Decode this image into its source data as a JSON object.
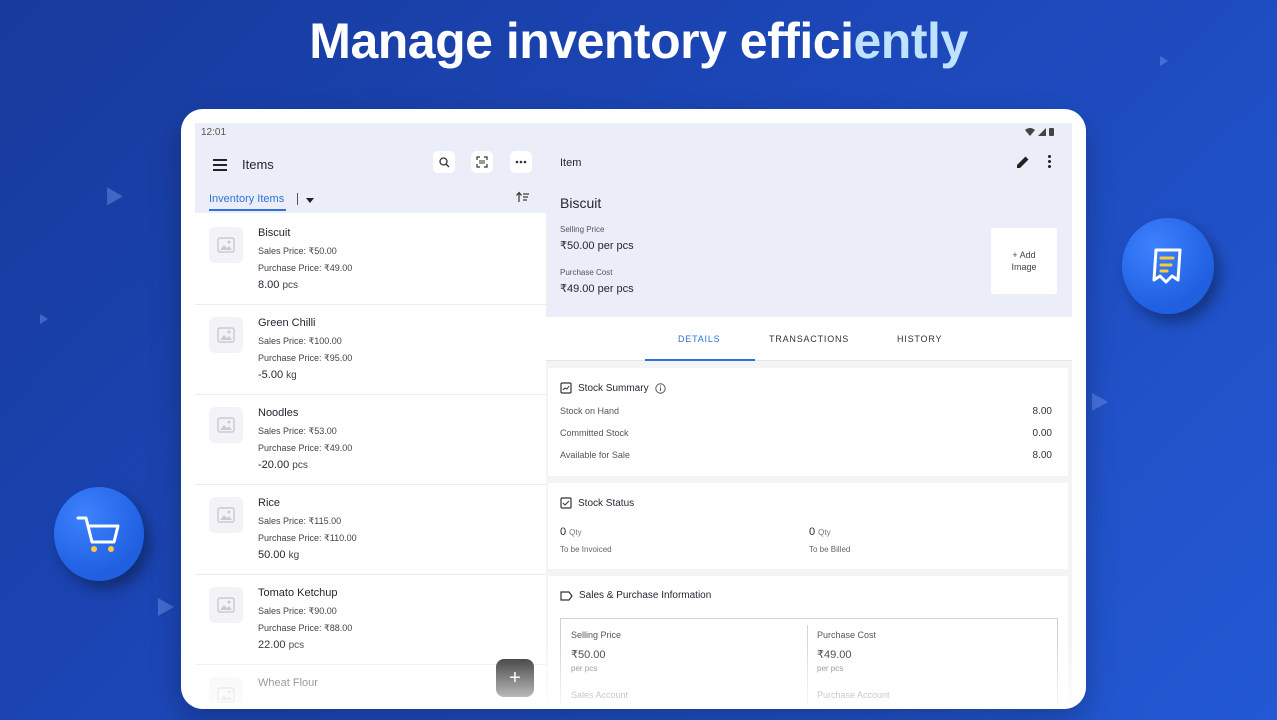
{
  "hero": {
    "title_main": "Manage inventory effici",
    "title_accent": "ently"
  },
  "statusbar": {
    "time": "12:01"
  },
  "left": {
    "title": "Items",
    "tab_label": "Inventory Items",
    "items": [
      {
        "name": "Biscuit",
        "sales": "Sales Price: ₹50.00",
        "purchase": "Purchase Price: ₹49.00",
        "qty": "8.00",
        "unit": "pcs"
      },
      {
        "name": "Green Chilli",
        "sales": "Sales Price: ₹100.00",
        "purchase": "Purchase Price: ₹95.00",
        "qty": "-5.00",
        "unit": "kg"
      },
      {
        "name": "Noodles",
        "sales": "Sales Price: ₹53.00",
        "purchase": "Purchase Price: ₹49.00",
        "qty": "-20.00",
        "unit": "pcs"
      },
      {
        "name": "Rice",
        "sales": "Sales Price: ₹115.00",
        "purchase": "Purchase Price: ₹110.00",
        "qty": "50.00",
        "unit": "kg"
      },
      {
        "name": "Tomato Ketchup",
        "sales": "Sales Price: ₹90.00",
        "purchase": "Purchase Price: ₹88.00",
        "qty": "22.00",
        "unit": "pcs"
      },
      {
        "name": "Wheat Flour",
        "sales": "",
        "purchase": "",
        "qty": "",
        "unit": ""
      }
    ],
    "fab_label": "+"
  },
  "right": {
    "title": "Item",
    "item_name": "Biscuit",
    "selling_price_label": "Selling Price",
    "selling_price_value": "₹50.00 per pcs",
    "purchase_cost_label": "Purchase Cost",
    "purchase_cost_value": "₹49.00 per pcs",
    "add_image_line1": "+ Add",
    "add_image_line2": "Image",
    "tabs": {
      "details": "DETAILS",
      "transactions": "TRANSACTIONS",
      "history": "HISTORY"
    },
    "stock_summary": {
      "title": "Stock Summary",
      "rows": [
        {
          "label": "Stock on Hand",
          "value": "8.00"
        },
        {
          "label": "Committed Stock",
          "value": "0.00"
        },
        {
          "label": "Available for Sale",
          "value": "8.00"
        }
      ]
    },
    "stock_status": {
      "title": "Stock Status",
      "invoiced_num": "0",
      "invoiced_unit": "Qty",
      "invoiced_label": "To be Invoiced",
      "billed_num": "0",
      "billed_unit": "Qty",
      "billed_label": "To be Billed"
    },
    "sales_purchase": {
      "title": "Sales & Purchase Information",
      "selling_label": "Selling Price",
      "selling_value": "₹50.00",
      "selling_unit": "per pcs",
      "purchase_label": "Purchase Cost",
      "purchase_value": "₹49.00",
      "purchase_unit": "per pcs",
      "sales_account_label": "Sales Account",
      "purchase_account_label": "Purchase Account"
    }
  },
  "colors": {
    "accent": "#2d72d9",
    "background": "#1c47b8",
    "header_tint": "#ebedf8"
  }
}
